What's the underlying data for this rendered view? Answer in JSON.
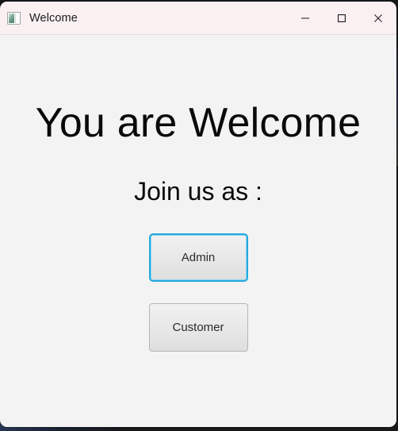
{
  "window": {
    "title": "Welcome",
    "icon": "app-window-icon",
    "titlebar_color": "#faf0f2",
    "content_color": "#f3f3f3",
    "controls": [
      {
        "name": "minimize",
        "label": "Minimize",
        "glyph": "minimize-icon"
      },
      {
        "name": "maximize",
        "label": "Maximize",
        "glyph": "maximize-icon"
      },
      {
        "name": "close",
        "label": "Close",
        "glyph": "close-icon"
      }
    ]
  },
  "content": {
    "heading": "You are Welcome",
    "subheading": "Join us as :",
    "buttons": [
      {
        "label": "Admin",
        "focused": true,
        "focus_color": "#22a9de"
      },
      {
        "label": "Customer",
        "focused": false
      }
    ]
  }
}
